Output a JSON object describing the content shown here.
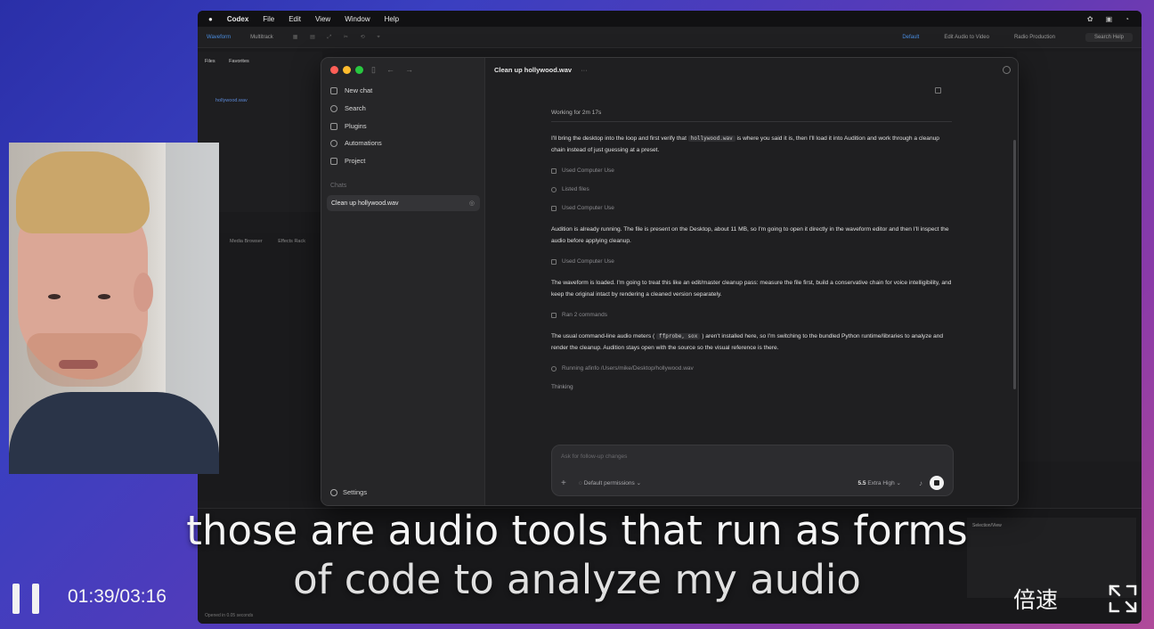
{
  "menubar": {
    "app_name": "Codex",
    "items": [
      "File",
      "Edit",
      "View",
      "Window",
      "Help"
    ]
  },
  "audition": {
    "tabs": [
      "Waveform",
      "Multitrack"
    ],
    "workspaces": [
      "Default",
      "Edit Audio to Video",
      "Radio Production"
    ],
    "search_help": "Search Help",
    "files_tab": "Files",
    "favorites_tab": "Favorites",
    "file_name": "hollywood.wav",
    "effects_tabs": [
      "Media Browser",
      "Effects Rack"
    ],
    "status_text": "Opened in 0.05 seconds",
    "selection_view": "Selection/View"
  },
  "codex": {
    "sidebar": {
      "new_chat": "New chat",
      "search": "Search",
      "plugins": "Plugins",
      "automations": "Automations",
      "project": "Project",
      "section_label": "Chats",
      "active_chat": "Clean up hollywood.wav",
      "settings": "Settings"
    },
    "main": {
      "title": "Clean up hollywood.wav",
      "more": "···",
      "working": "Working for 2m 17s",
      "messages": [
        {
          "pre": "I'll bring the desktop into the loop and first verify that ",
          "code": "hollywood.wav",
          "post": " is where you said it is, then I'll load it into Audition and work through a cleanup chain instead of just guessing at a preset."
        },
        {
          "text": "Audition is already running. The file is present on the Desktop, about 11 MB, so I'm going to open it directly in the waveform editor and then I'll inspect the audio before applying cleanup."
        },
        {
          "text": "The waveform is loaded. I'm going to treat this like an edit/master cleanup pass: measure the file first, build a conservative chain for voice intelligibility, and keep the original intact by rendering a cleaned version separately."
        },
        {
          "pre": "The usual command-line audio meters ( ",
          "code": "ffprobe, sox",
          "post": " ) aren't installed here, so I'm switching to the bundled Python runtime/libraries to analyze and render the cleanup. Audition stays open with the source so the visual reference is there."
        }
      ],
      "steps": [
        "Used Computer Use",
        "Listed files",
        "Used Computer Use",
        "Used Computer Use",
        "Ran 2 commands",
        "Running afinfo /Users/mike/Desktop/hollywood.wav"
      ],
      "thinking": "Thinking"
    },
    "composer": {
      "placeholder": "Ask for follow-up changes",
      "permissions": "Default permissions",
      "model_name": "5.5",
      "model_level": "Extra High"
    }
  },
  "player": {
    "subtitle_line1": "those are audio tools that run as forms",
    "subtitle_line2": "of code to analyze my audio",
    "time": "01:39/03:16",
    "speed_label": "倍速"
  }
}
